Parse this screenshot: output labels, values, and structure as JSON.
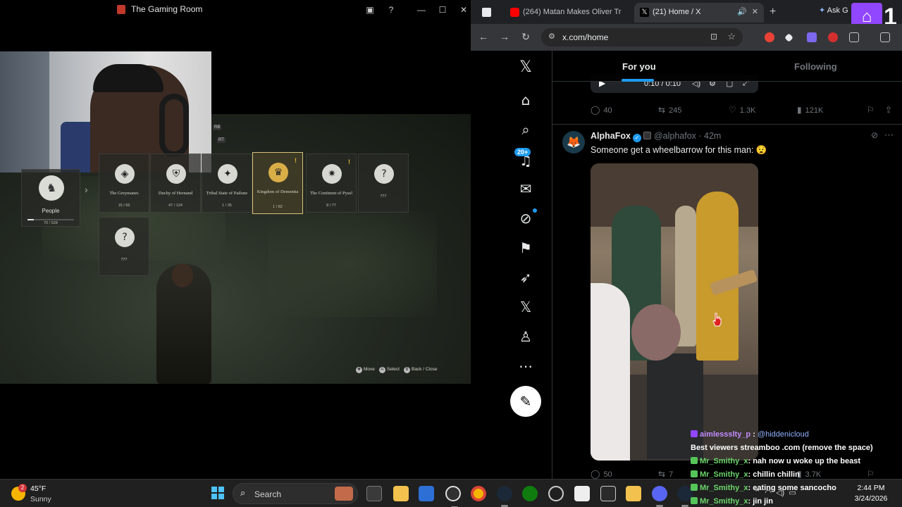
{
  "game": {
    "window_title": "The Gaming Room",
    "people": {
      "label": "People",
      "count": "70 / 528",
      "progress": 0.13
    },
    "categories": [
      {
        "name": "The Greymanes",
        "count": "15 / 65",
        "alert": false,
        "selected": false,
        "icon": "wolf-emblem"
      },
      {
        "name": "Duchy of Hernand",
        "count": "47 / 124",
        "alert": false,
        "selected": false,
        "icon": "shield-emblem"
      },
      {
        "name": "Tribal State of Pailune",
        "count": "1 / 35",
        "alert": false,
        "selected": false,
        "icon": "beast-emblem"
      },
      {
        "name": "Kingdom of Dementia",
        "count": "1 / 82",
        "alert": true,
        "selected": true,
        "icon": "crown-emblem"
      },
      {
        "name": "The Continent of Pysel",
        "count": "8 / 77",
        "alert": true,
        "selected": false,
        "icon": "star-emblem"
      },
      {
        "name": "???",
        "count": "",
        "alert": false,
        "selected": false,
        "icon": "question-emblem"
      }
    ],
    "locked_row": [
      {
        "name": "???",
        "icon": "question-emblem"
      }
    ],
    "rb": "RB",
    "rt": "RT",
    "controls": {
      "move": "Move",
      "select": "Select",
      "back": "Back / Close",
      "select_btn": "A",
      "back_btn": "B"
    }
  },
  "browser": {
    "tabs": [
      {
        "title": "",
        "favicon_color": "#e8eaed"
      },
      {
        "title": "(264) Matan Makes Oliver Tr",
        "favicon_color": "#ff0000"
      },
      {
        "title": "(21) Home / X",
        "favicon_color": "#000000",
        "active": true
      }
    ],
    "ask_label": "Ask G",
    "twitch_count": "1",
    "url": "x.com/home"
  },
  "x": {
    "feed_tabs": {
      "for_you": "For you",
      "following": "Following"
    },
    "audio": {
      "time": "0:10 / 0:10"
    },
    "prev_actions": {
      "replies": "40",
      "reposts": "245",
      "likes": "1.3K",
      "views": "121K"
    },
    "notifications_badge": "20+",
    "tweet": {
      "display_name": "AlphaFox",
      "handle": "@alphafox",
      "ago": "42m",
      "text": "Someone get a wheelbarrow for this man: 😧",
      "actions": {
        "replies": "50",
        "reposts": "7",
        "likes": "",
        "views": "3.7K"
      }
    }
  },
  "chat": [
    {
      "user": "aimlessslty_p",
      "color": "purple",
      "mention": "@hiddenicloud",
      "message": "Best viewers streamboo .com (remove the space)"
    },
    {
      "user": "Mr_Smithy_x",
      "color": "green",
      "mention": "",
      "message": ": nah now u woke up the beast"
    },
    {
      "user": "Mr_Smithy_x",
      "color": "green",
      "mention": "",
      "message": ": chillin chillin"
    },
    {
      "user": "Mr_Smithy_x",
      "color": "green",
      "mention": "",
      "message": ": eating some sancocho"
    },
    {
      "user": "Mr_Smithy_x",
      "color": "green",
      "mention": "",
      "message": ": jin jin"
    }
  ],
  "taskbar": {
    "weather": {
      "temp": "45°F",
      "condition": "Sunny",
      "badge": "2"
    },
    "search_label": "Search",
    "time": "2:44 PM",
    "date": "3/24/2026",
    "apps": [
      "task-view",
      "file-explorer",
      "microsoft-store",
      "obs",
      "chrome",
      "steam",
      "xbox",
      "app-circle",
      "7zip",
      "epic-games",
      "roblox",
      "discord",
      "steam-alt",
      "twitch"
    ]
  }
}
